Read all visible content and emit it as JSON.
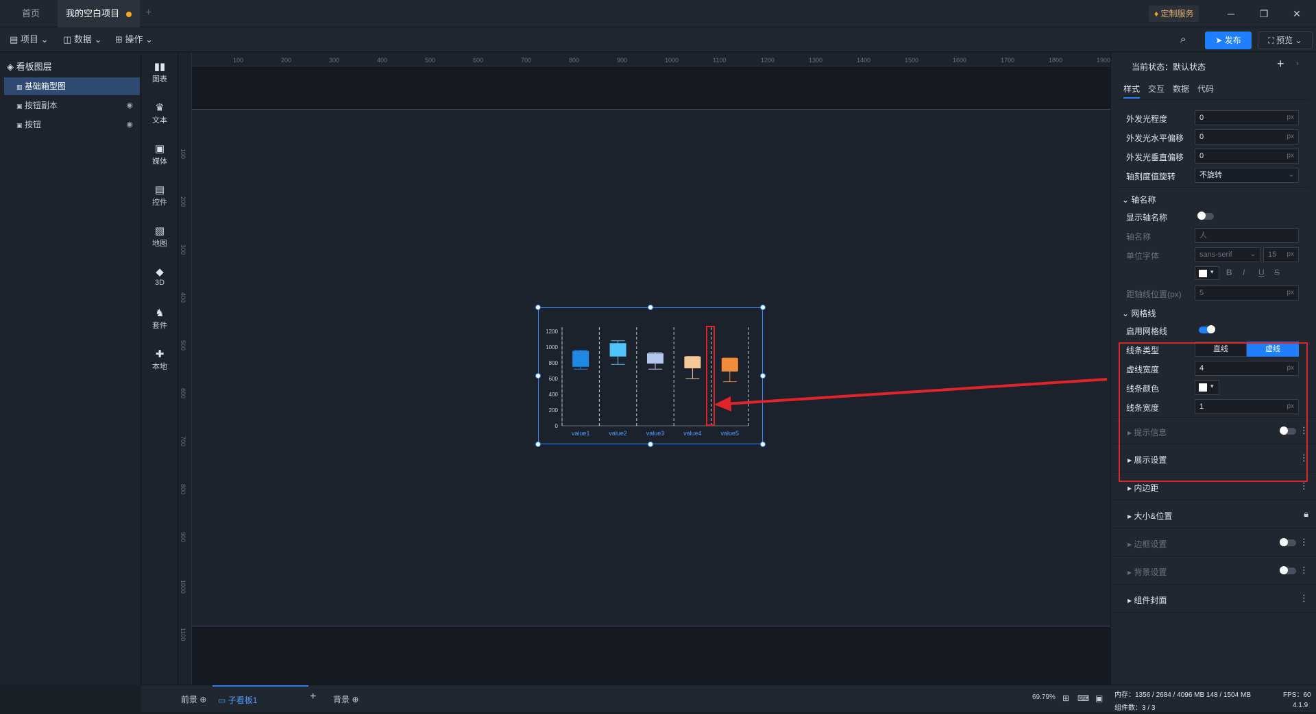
{
  "tabs": [
    {
      "label": "首页"
    },
    {
      "label": "我的空白项目",
      "modified": true
    }
  ],
  "titlebar": {
    "custom_service": "定制服务"
  },
  "toolbar": {
    "project": "项目",
    "data": "数据",
    "operation": "操作",
    "publish": "发布",
    "preview": "预览"
  },
  "layers": {
    "title": "看板图层",
    "items": [
      {
        "label": "基础箱型图",
        "selected": true
      },
      {
        "label": "按钮副本",
        "hidden": true
      },
      {
        "label": "按钮",
        "hidden": true
      }
    ]
  },
  "components": [
    {
      "label": "图表",
      "icon": "chart-icon"
    },
    {
      "label": "文本",
      "icon": "text-icon"
    },
    {
      "label": "媒体",
      "icon": "media-icon"
    },
    {
      "label": "控件",
      "icon": "control-icon"
    },
    {
      "label": "地图",
      "icon": "map-icon"
    },
    {
      "label": "3D",
      "icon": "cube-icon"
    },
    {
      "label": "套件",
      "icon": "kit-icon"
    },
    {
      "label": "本地",
      "icon": "puzzle-icon"
    }
  ],
  "ruler": {
    "top": [
      "100",
      "200",
      "300",
      "400",
      "500",
      "600",
      "700",
      "800",
      "900",
      "1000",
      "1100",
      "1200",
      "1300",
      "1400",
      "1500",
      "1600",
      "1700",
      "1800",
      "1900"
    ],
    "left": [
      "100",
      "200",
      "300",
      "400",
      "500",
      "600",
      "700",
      "800",
      "900",
      "1000",
      "1100"
    ]
  },
  "chart_data": {
    "type": "boxplot",
    "categories": [
      "value1",
      "value2",
      "value3",
      "value4",
      "value5"
    ],
    "yticks": [
      "0",
      "200",
      "400",
      "600",
      "800",
      "1000",
      "1200"
    ],
    "ylim": [
      0,
      1200
    ],
    "boxes": [
      {
        "min": 720,
        "q1": 750,
        "q3": 950,
        "max": 960,
        "color": "#1e88e5"
      },
      {
        "min": 780,
        "q1": 880,
        "q3": 1050,
        "max": 1080,
        "color": "#4fc3f7"
      },
      {
        "min": 720,
        "q1": 790,
        "q3": 920,
        "max": 930,
        "color": "#b3c7ef"
      },
      {
        "min": 600,
        "q1": 730,
        "q3": 880,
        "max": 880,
        "color": "#f5c89a"
      },
      {
        "min": 560,
        "q1": 690,
        "q3": 860,
        "max": 860,
        "color": "#f08c3a"
      }
    ]
  },
  "props": {
    "state_label": "当前状态：默认状态",
    "tabs": [
      "样式",
      "交互",
      "数据",
      "代码"
    ],
    "glow": [
      {
        "label": "外发光程度",
        "value": "0",
        "unit": "px"
      },
      {
        "label": "外发光水平偏移",
        "value": "0",
        "unit": "px"
      },
      {
        "label": "外发光垂直偏移",
        "value": "0",
        "unit": "px"
      }
    ],
    "rotate_label": "轴刻度值旋转",
    "rotate_value": "不旋转",
    "axis_name_section": "轴名称",
    "show_axis_name": "显示轴名称",
    "axis_name_label": "轴名称",
    "axis_name_placeholder": "人",
    "unit_font_label": "单位字体",
    "unit_font_value": "sans-serif",
    "unit_font_size": "15",
    "unit_px": "px",
    "axis_distance_label": "距轴线位置(px)",
    "axis_distance_value": "5",
    "gridline_section": "网格线",
    "enable_gridline": "启用网格线",
    "line_type_label": "线条类型",
    "line_type_solid": "直线",
    "line_type_dashed": "虚线",
    "dash_width_label": "虚线宽度",
    "dash_width_value": "4",
    "line_color_label": "线条颜色",
    "line_width_label": "线条宽度",
    "line_width_value": "1",
    "sections": [
      {
        "label": "提示信息",
        "dim": true,
        "control": "toggle"
      },
      {
        "label": "展示设置",
        "dim": false,
        "control": "kebab"
      },
      {
        "label": "内边距",
        "dim": false,
        "control": "kebab"
      },
      {
        "label": "大小&位置",
        "dim": false,
        "control": "lock"
      },
      {
        "label": "边框设置",
        "dim": true,
        "control": "toggle"
      },
      {
        "label": "背景设置",
        "dim": true,
        "control": "toggle"
      },
      {
        "label": "组件封面",
        "dim": false,
        "control": "kebab"
      }
    ]
  },
  "bottom": {
    "foreground": "前景",
    "sub_board": "子看板1",
    "background": "背景",
    "zoom": "69.79%"
  },
  "status": {
    "memory": "内存：1356 / 2684 / 4096 MB  148 / 1504 MB",
    "fps": "FPS：60",
    "components": "组件数：3 / 3",
    "version": "4.1.9"
  }
}
